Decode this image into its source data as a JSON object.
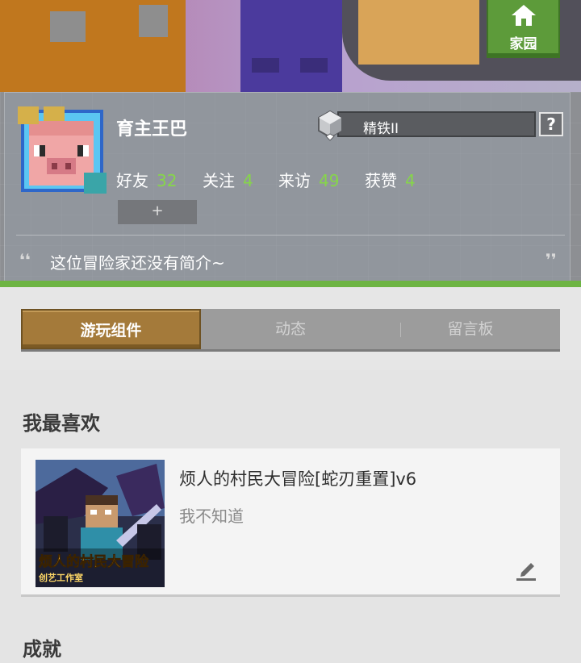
{
  "header": {
    "home_label": "家园",
    "home_icon": "home-icon"
  },
  "profile": {
    "username": "育主王巴",
    "rank": "精铁II",
    "help_label": "?",
    "stats": [
      {
        "label": "好友",
        "value": "32"
      },
      {
        "label": "关注",
        "value": "4"
      },
      {
        "label": "来访",
        "value": "49"
      },
      {
        "label": "获赞",
        "value": "4"
      }
    ],
    "add_label": "+",
    "bio": "这位冒险家还没有简介~",
    "quote_open": "❛❛",
    "quote_close": "❜❜"
  },
  "tabs": [
    {
      "label": "游玩组件",
      "active": true
    },
    {
      "label": "动态",
      "active": false
    },
    {
      "label": "留言板",
      "active": false
    }
  ],
  "favorites": {
    "section_title": "我最喜欢",
    "item": {
      "title": "烦人的村民大冒险[蛇刃重置]v6",
      "desc": "我不知道",
      "thumb_caption": "烦人的村民大冒险",
      "thumb_sub": "创艺工作室"
    }
  },
  "achievements": {
    "section_title": "成就"
  },
  "colors": {
    "accent_green": "#6db443",
    "stat_green": "#86d649",
    "tab_active": "#a47a3a"
  }
}
